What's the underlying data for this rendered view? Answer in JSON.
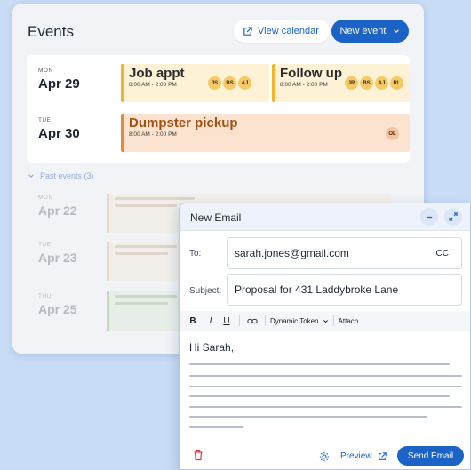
{
  "events": {
    "title": "Events",
    "view_calendar_label": "View calendar",
    "new_event_label": "New event",
    "upcoming": [
      {
        "dow": "MON",
        "date": "Apr 29",
        "items": [
          {
            "title": "Job appt",
            "time": "8:00 AM - 2:00 PM",
            "attendees": [
              "JS",
              "BS",
              "AJ"
            ]
          },
          {
            "title": "Follow up",
            "time": "8:00 AM - 2:00 PM",
            "attendees": [
              "JR",
              "BS",
              "AJ",
              "RL"
            ]
          }
        ]
      },
      {
        "dow": "TUE",
        "date": "Apr 30",
        "items": [
          {
            "title": "Dumpster pickup",
            "time": "8:00 AM - 2:00 PM",
            "attendees": [
              "OL"
            ]
          }
        ]
      }
    ],
    "past_label": "Past events (3)",
    "past": [
      {
        "dow": "MON",
        "date": "Apr 22"
      },
      {
        "dow": "TUE",
        "date": "Apr 23"
      },
      {
        "dow": "THU",
        "date": "Apr 25"
      }
    ]
  },
  "colors": {
    "accent": "#1b63c6",
    "event_yellow": "#fdf1d6",
    "event_yellow_border": "#f2b42d",
    "event_orange": "#fbe3cf",
    "event_orange_border": "#e9883b",
    "event_green": "#dcebd7",
    "event_green_border": "#7bb66c",
    "delete": "#d93a3a"
  },
  "email": {
    "title": "New Email",
    "to_label": "To:",
    "to_value": "sarah.jones@gmail.com",
    "cc_label": "CC",
    "subject_label": "Subject:",
    "subject_value": "Proposal for 431 Laddybroke Lane",
    "toolbar": {
      "bold": "B",
      "italic": "I",
      "underline": "U",
      "dynamic_token": "Dynamic Token",
      "attach": "Attach"
    },
    "greeting": "Hi Sarah,",
    "preview_label": "Preview",
    "send_label": "Send Email"
  }
}
